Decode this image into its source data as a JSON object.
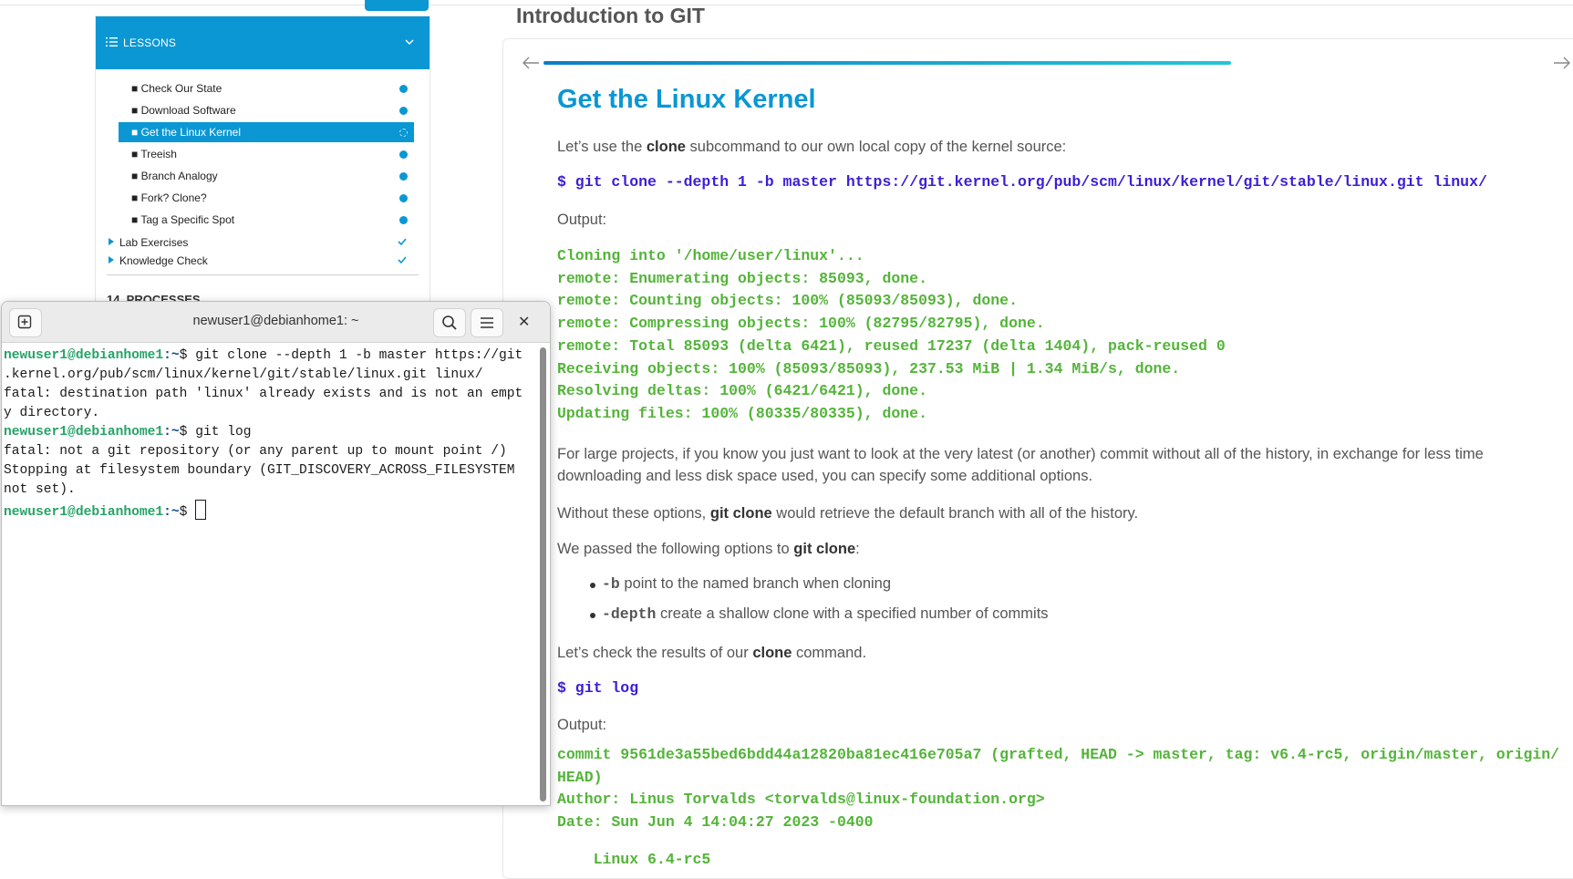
{
  "sidebar": {
    "header": "LESSONS",
    "lessons": [
      {
        "label": "■ Check Our State"
      },
      {
        "label": "■ Download Software"
      },
      {
        "label": "■ Get the Linux Kernel",
        "active": true
      },
      {
        "label": "■ Treeish"
      },
      {
        "label": "■ Branch Analogy"
      },
      {
        "label": "■ Fork? Clone?"
      },
      {
        "label": "■ Tag a Specific Spot"
      }
    ],
    "groups": [
      {
        "label": "Lab Exercises"
      },
      {
        "label": "Knowledge Check"
      }
    ],
    "next_section": "14. PROCESSES"
  },
  "page": {
    "title": "Introduction to GIT",
    "heading": "Get the Linux Kernel",
    "intro_pre": "Let’s use the ",
    "intro_bold": "clone",
    "intro_post": " subcommand to our own local copy of the kernel source:",
    "clone_cmd": "$ git clone --depth 1 -b master https://git.kernel.org/pub/scm/linux/kernel/git/stable/linux.git linux/",
    "output_label": "Output:",
    "clone_output": [
      "Cloning into '/home/user/linux'...",
      "remote: Enumerating objects: 85093, done.",
      "remote: Counting objects: 100% (85093/85093), done.",
      "remote: Compressing objects: 100% (82795/82795), done.",
      "remote: Total 85093 (delta 6421), reused 17237 (delta 1404), pack-reused 0",
      "Receiving objects: 100% (85093/85093), 237.53 MiB | 1.34 MiB/s, done.",
      "Resolving deltas: 100% (6421/6421), done.",
      "Updating files: 100% (80335/80335), done."
    ],
    "large_projects": "For large projects, if you know you just want to look at the very latest (or another) commit without all of the history, in exchange for less time downloading and less disk space used, you can specify some additional options.",
    "without_pre": "Without these options, ",
    "without_bold": "git clone",
    "without_post": " would retrieve the default branch with all of the history.",
    "passed_pre": "We passed the following options to ",
    "passed_bold": "git clone",
    "passed_post": ":",
    "options": [
      {
        "flag": "-b",
        "desc": " point to the named branch when cloning"
      },
      {
        "flag": "-depth",
        "desc": " create a shallow clone with a specified number of commits"
      }
    ],
    "check_pre": "Let’s check the results of our ",
    "check_bold": "clone",
    "check_post": " command.",
    "log_cmd": "$ git log",
    "output_label2": "Output:",
    "log_output": [
      "commit 9561de3a55bed6bdd44a12820ba81ec416e705a7 (grafted, HEAD -> master, tag: v6.4-rc5, origin/master, origin/",
      "HEAD)",
      "Author: Linus Torvalds <torvalds@linux-foundation.org>",
      "Date: Sun Jun 4 14:04:27 2023 -0400",
      "",
      "    Linux 6.4-rc5"
    ]
  },
  "terminal": {
    "title": "newuser1@debianhome1: ~",
    "prompt_user": "newuser1@debianhome1",
    "prompt_path": ":~",
    "prompt_sym": "$ ",
    "cmd1": "git clone --depth 1 -b master https://git",
    "cmd1_wrap": ".kernel.org/pub/scm/linux/kernel/git/stable/linux.git linux/",
    "err1a": "fatal: destination path 'linux' already exists and is not an empt",
    "err1b": "y directory.",
    "cmd2": "git log",
    "err2a": "fatal: not a git repository (or any parent up to mount point /)",
    "err2b": "Stopping at filesystem boundary (GIT_DISCOVERY_ACROSS_FILESYSTEM",
    "err2c": "not set)."
  },
  "colors": {
    "accent": "#0a97d4",
    "command": "#3b1fd6",
    "output": "#54b43a",
    "prompt_user": "#26a269"
  }
}
